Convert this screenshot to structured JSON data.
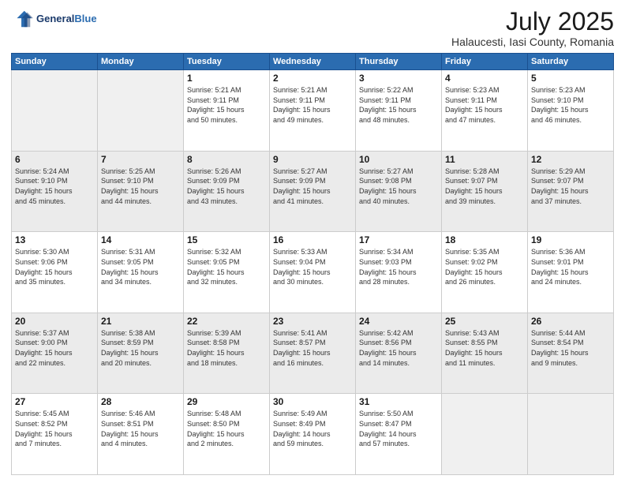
{
  "header": {
    "logo_line1": "General",
    "logo_line2": "Blue",
    "main_title": "July 2025",
    "subtitle": "Halaucesti, Iasi County, Romania"
  },
  "weekdays": [
    "Sunday",
    "Monday",
    "Tuesday",
    "Wednesday",
    "Thursday",
    "Friday",
    "Saturday"
  ],
  "weeks": [
    [
      {
        "day": "",
        "info": ""
      },
      {
        "day": "",
        "info": ""
      },
      {
        "day": "1",
        "info": "Sunrise: 5:21 AM\nSunset: 9:11 PM\nDaylight: 15 hours\nand 50 minutes."
      },
      {
        "day": "2",
        "info": "Sunrise: 5:21 AM\nSunset: 9:11 PM\nDaylight: 15 hours\nand 49 minutes."
      },
      {
        "day": "3",
        "info": "Sunrise: 5:22 AM\nSunset: 9:11 PM\nDaylight: 15 hours\nand 48 minutes."
      },
      {
        "day": "4",
        "info": "Sunrise: 5:23 AM\nSunset: 9:11 PM\nDaylight: 15 hours\nand 47 minutes."
      },
      {
        "day": "5",
        "info": "Sunrise: 5:23 AM\nSunset: 9:10 PM\nDaylight: 15 hours\nand 46 minutes."
      }
    ],
    [
      {
        "day": "6",
        "info": "Sunrise: 5:24 AM\nSunset: 9:10 PM\nDaylight: 15 hours\nand 45 minutes."
      },
      {
        "day": "7",
        "info": "Sunrise: 5:25 AM\nSunset: 9:10 PM\nDaylight: 15 hours\nand 44 minutes."
      },
      {
        "day": "8",
        "info": "Sunrise: 5:26 AM\nSunset: 9:09 PM\nDaylight: 15 hours\nand 43 minutes."
      },
      {
        "day": "9",
        "info": "Sunrise: 5:27 AM\nSunset: 9:09 PM\nDaylight: 15 hours\nand 41 minutes."
      },
      {
        "day": "10",
        "info": "Sunrise: 5:27 AM\nSunset: 9:08 PM\nDaylight: 15 hours\nand 40 minutes."
      },
      {
        "day": "11",
        "info": "Sunrise: 5:28 AM\nSunset: 9:07 PM\nDaylight: 15 hours\nand 39 minutes."
      },
      {
        "day": "12",
        "info": "Sunrise: 5:29 AM\nSunset: 9:07 PM\nDaylight: 15 hours\nand 37 minutes."
      }
    ],
    [
      {
        "day": "13",
        "info": "Sunrise: 5:30 AM\nSunset: 9:06 PM\nDaylight: 15 hours\nand 35 minutes."
      },
      {
        "day": "14",
        "info": "Sunrise: 5:31 AM\nSunset: 9:05 PM\nDaylight: 15 hours\nand 34 minutes."
      },
      {
        "day": "15",
        "info": "Sunrise: 5:32 AM\nSunset: 9:05 PM\nDaylight: 15 hours\nand 32 minutes."
      },
      {
        "day": "16",
        "info": "Sunrise: 5:33 AM\nSunset: 9:04 PM\nDaylight: 15 hours\nand 30 minutes."
      },
      {
        "day": "17",
        "info": "Sunrise: 5:34 AM\nSunset: 9:03 PM\nDaylight: 15 hours\nand 28 minutes."
      },
      {
        "day": "18",
        "info": "Sunrise: 5:35 AM\nSunset: 9:02 PM\nDaylight: 15 hours\nand 26 minutes."
      },
      {
        "day": "19",
        "info": "Sunrise: 5:36 AM\nSunset: 9:01 PM\nDaylight: 15 hours\nand 24 minutes."
      }
    ],
    [
      {
        "day": "20",
        "info": "Sunrise: 5:37 AM\nSunset: 9:00 PM\nDaylight: 15 hours\nand 22 minutes."
      },
      {
        "day": "21",
        "info": "Sunrise: 5:38 AM\nSunset: 8:59 PM\nDaylight: 15 hours\nand 20 minutes."
      },
      {
        "day": "22",
        "info": "Sunrise: 5:39 AM\nSunset: 8:58 PM\nDaylight: 15 hours\nand 18 minutes."
      },
      {
        "day": "23",
        "info": "Sunrise: 5:41 AM\nSunset: 8:57 PM\nDaylight: 15 hours\nand 16 minutes."
      },
      {
        "day": "24",
        "info": "Sunrise: 5:42 AM\nSunset: 8:56 PM\nDaylight: 15 hours\nand 14 minutes."
      },
      {
        "day": "25",
        "info": "Sunrise: 5:43 AM\nSunset: 8:55 PM\nDaylight: 15 hours\nand 11 minutes."
      },
      {
        "day": "26",
        "info": "Sunrise: 5:44 AM\nSunset: 8:54 PM\nDaylight: 15 hours\nand 9 minutes."
      }
    ],
    [
      {
        "day": "27",
        "info": "Sunrise: 5:45 AM\nSunset: 8:52 PM\nDaylight: 15 hours\nand 7 minutes."
      },
      {
        "day": "28",
        "info": "Sunrise: 5:46 AM\nSunset: 8:51 PM\nDaylight: 15 hours\nand 4 minutes."
      },
      {
        "day": "29",
        "info": "Sunrise: 5:48 AM\nSunset: 8:50 PM\nDaylight: 15 hours\nand 2 minutes."
      },
      {
        "day": "30",
        "info": "Sunrise: 5:49 AM\nSunset: 8:49 PM\nDaylight: 14 hours\nand 59 minutes."
      },
      {
        "day": "31",
        "info": "Sunrise: 5:50 AM\nSunset: 8:47 PM\nDaylight: 14 hours\nand 57 minutes."
      },
      {
        "day": "",
        "info": ""
      },
      {
        "day": "",
        "info": ""
      }
    ]
  ]
}
